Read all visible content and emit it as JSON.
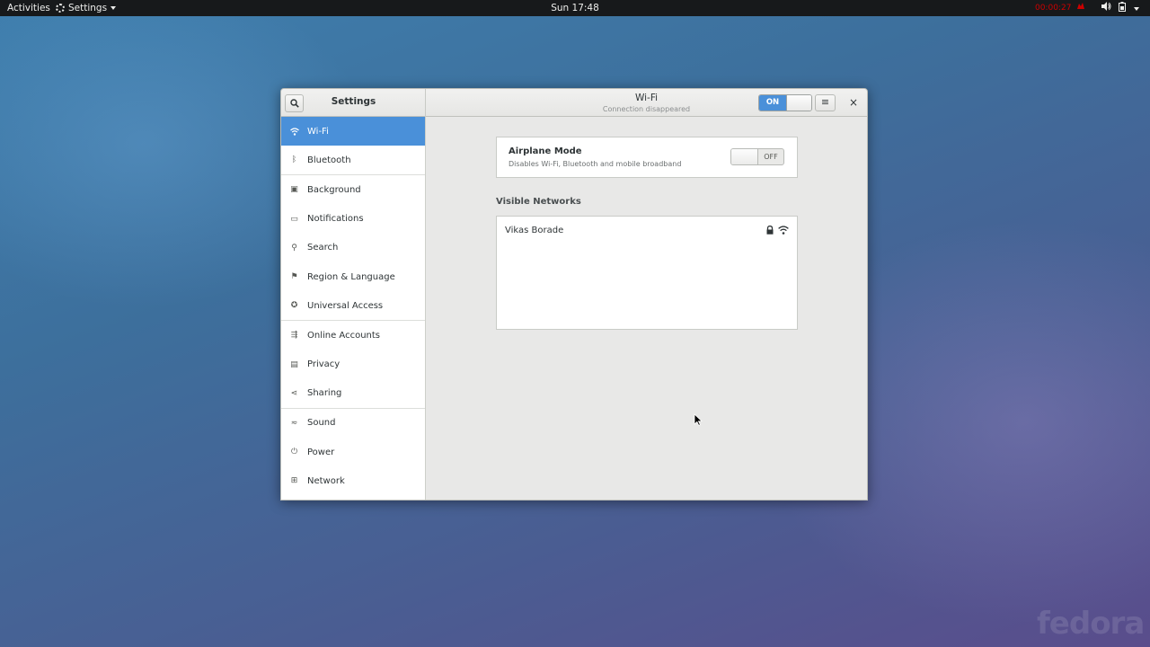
{
  "topbar": {
    "activities": "Activities",
    "app_menu": "Settings",
    "clock": "Sun 17:48",
    "recording_time": "00:00:27"
  },
  "window": {
    "sidebar_title": "Settings",
    "title": "Wi-Fi",
    "subtitle": "Connection disappeared",
    "wifi_switch_label": "ON",
    "menu_glyph": "≡",
    "close_glyph": "×"
  },
  "sidebar": {
    "items": [
      {
        "label": "Wi-Fi",
        "icon": "wifi-icon",
        "glyph": "⌔"
      },
      {
        "label": "Bluetooth",
        "icon": "bluetooth-icon",
        "glyph": "ᛒ"
      },
      {
        "label": "Background",
        "icon": "background-icon",
        "glyph": "▣"
      },
      {
        "label": "Notifications",
        "icon": "notifications-icon",
        "glyph": "▭"
      },
      {
        "label": "Search",
        "icon": "search-icon",
        "glyph": "⚲"
      },
      {
        "label": "Region & Language",
        "icon": "region-icon",
        "glyph": "⚑"
      },
      {
        "label": "Universal Access",
        "icon": "universal-access-icon",
        "glyph": "✪"
      },
      {
        "label": "Online Accounts",
        "icon": "online-accounts-icon",
        "glyph": "⇶"
      },
      {
        "label": "Privacy",
        "icon": "privacy-icon",
        "glyph": "▤"
      },
      {
        "label": "Sharing",
        "icon": "sharing-icon",
        "glyph": "⋖"
      },
      {
        "label": "Sound",
        "icon": "sound-icon",
        "glyph": "≂"
      },
      {
        "label": "Power",
        "icon": "power-icon",
        "glyph": "⏻"
      },
      {
        "label": "Network",
        "icon": "network-icon",
        "glyph": "⊞"
      }
    ]
  },
  "airplane": {
    "title": "Airplane Mode",
    "subtitle": "Disables Wi-Fi, Bluetooth and mobile broadband",
    "switch_label": "OFF"
  },
  "networks": {
    "title": "Visible Networks",
    "items": [
      {
        "name": "Vikas Borade",
        "secured": true
      }
    ]
  },
  "colors": {
    "accent": "#4a90d9",
    "recording": "#cc0000"
  },
  "watermark": "fedora"
}
